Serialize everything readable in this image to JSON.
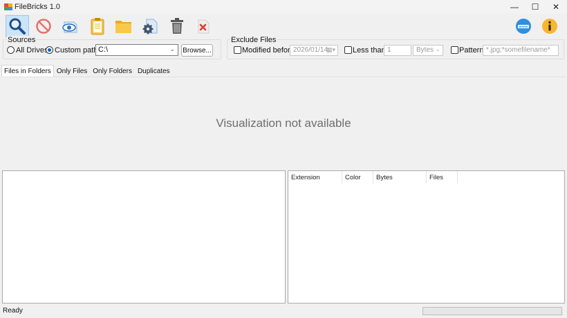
{
  "window": {
    "title": "FileBricks 1.0",
    "minimize_glyph": "—",
    "maximize_glyph": "☐",
    "close_glyph": "✕"
  },
  "toolbar": {
    "buttons": [
      {
        "icon": "search-icon",
        "active": true
      },
      {
        "icon": "stop-icon",
        "active": false
      },
      {
        "icon": "view-icon",
        "active": false
      },
      {
        "icon": "clipboard-icon",
        "active": false
      },
      {
        "icon": "folder-icon",
        "active": false
      },
      {
        "icon": "settings-icon",
        "active": false
      },
      {
        "icon": "trash-icon",
        "active": false
      },
      {
        "icon": "remove-icon",
        "active": false
      }
    ],
    "right_buttons": [
      {
        "icon": "www-icon"
      },
      {
        "icon": "info-icon"
      }
    ]
  },
  "sources": {
    "title": "Sources",
    "all_drives_label": "All Drives",
    "custom_path_label": "Custom path:",
    "selected": "custom_path",
    "path_value": "C:\\",
    "browse_label": "Browse..."
  },
  "exclude": {
    "title": "Exclude Files",
    "modified_before_label": "Modified before:",
    "modified_before_value": "2026/01/14",
    "less_than_label": "Less than",
    "less_than_value": "1",
    "unit_value": "Bytes",
    "pattern_label": "Pattern",
    "pattern_value": "*.jpg;*somefilename*"
  },
  "tabs": [
    {
      "label": "Files in Folders",
      "active": true
    },
    {
      "label": "Only Files",
      "active": false
    },
    {
      "label": "Only Folders",
      "active": false
    },
    {
      "label": "Duplicates",
      "active": false
    }
  ],
  "visualization": {
    "message": "Visualization not available"
  },
  "extension_table": {
    "columns": [
      "Extension",
      "Color",
      "Bytes",
      "Files"
    ]
  },
  "status": {
    "text": "Ready",
    "progress": 0
  },
  "colors": {
    "accent": "#0a5fb4",
    "background": "#f0f0f0",
    "selected_button": "#cce4f7"
  }
}
